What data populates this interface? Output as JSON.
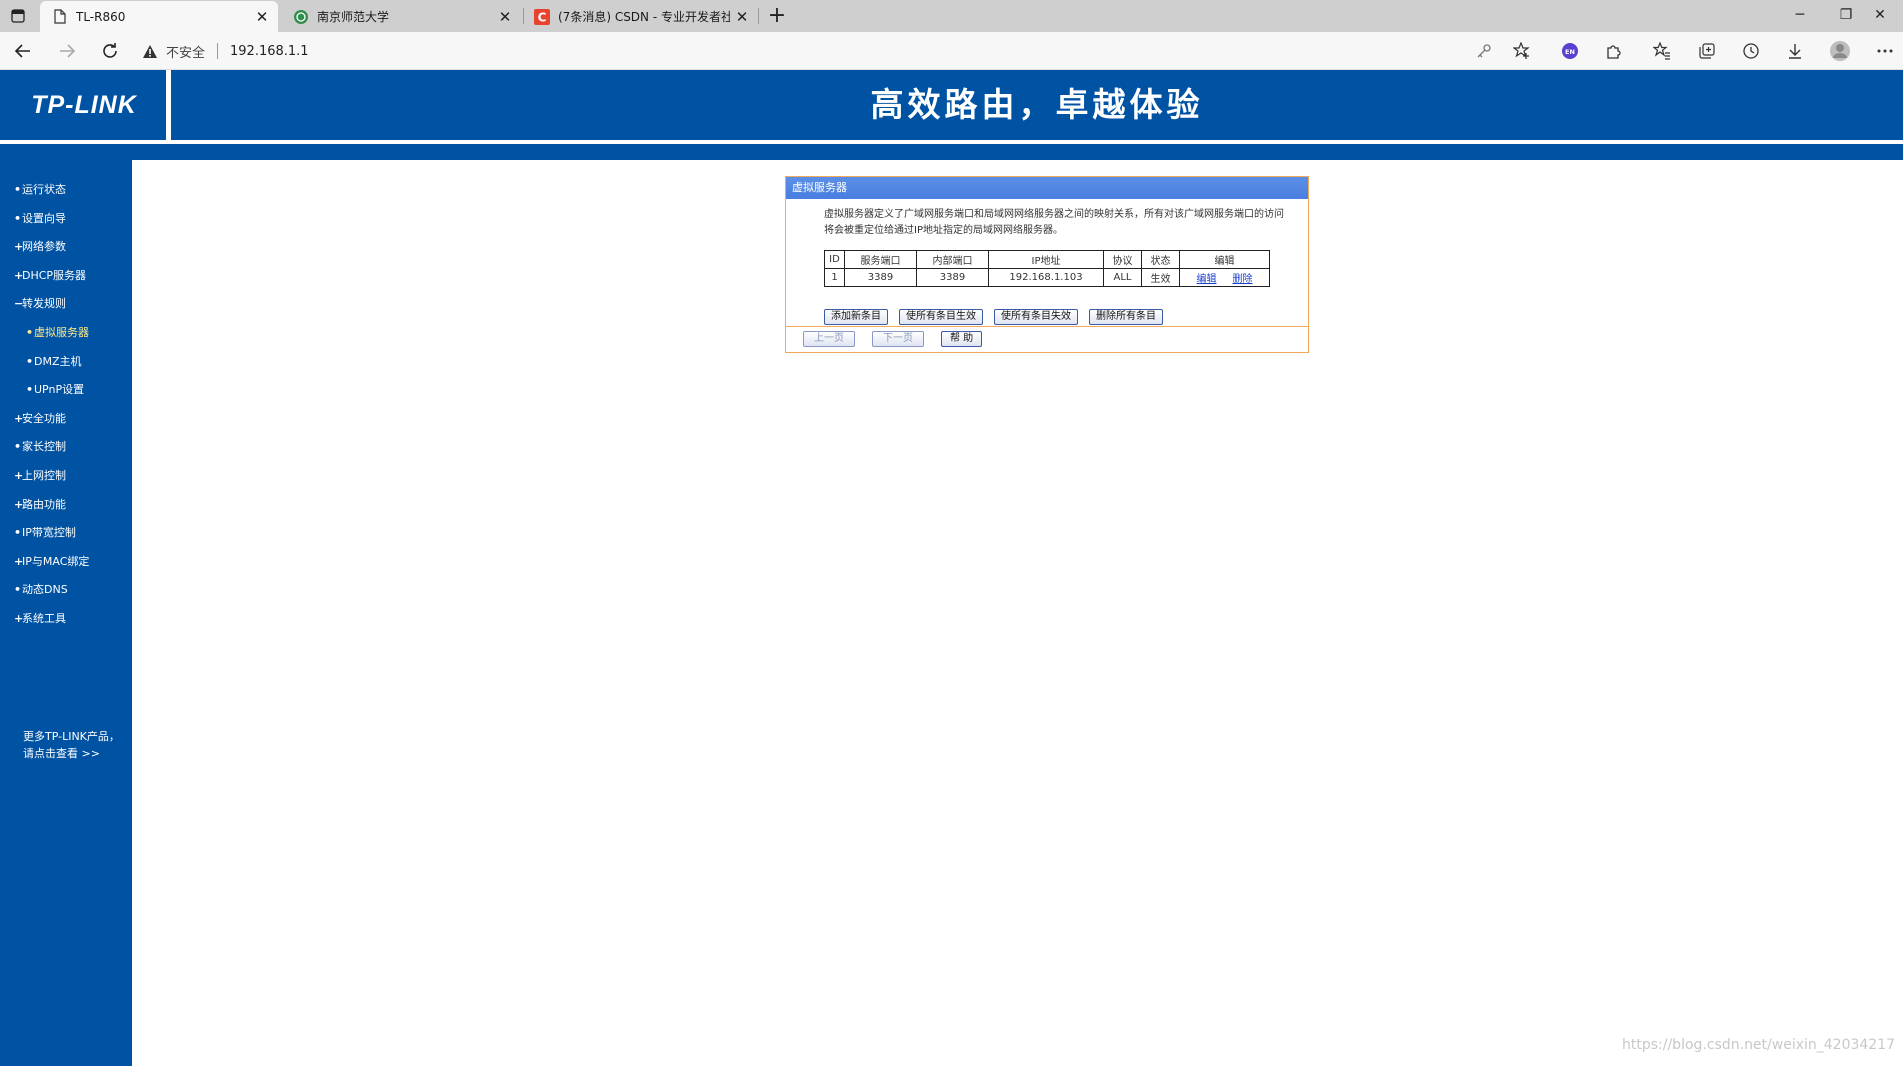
{
  "browser": {
    "tabs": [
      {
        "title": "TL-R860",
        "icon": "page-icon",
        "active": true
      },
      {
        "title": "南京师范大学",
        "icon": "university-icon",
        "active": false
      },
      {
        "title": "(7条消息) CSDN - 专业开发者社",
        "icon": "csdn-icon",
        "active": false
      }
    ],
    "new_tab_label": "+",
    "address": {
      "security_label": "不安全",
      "url": "192.168.1.1"
    },
    "window_controls": {
      "minimize": "─",
      "restore": "❐",
      "close": "✕"
    },
    "extension_badge": "EN"
  },
  "header": {
    "logo": "TP-LINK",
    "slogan": "高效路由，卓越体验"
  },
  "sidebar": {
    "items": [
      {
        "bullet": "•",
        "label": "运行状态"
      },
      {
        "bullet": "•",
        "label": "设置向导"
      },
      {
        "bullet": "+",
        "label": "网络参数"
      },
      {
        "bullet": "+",
        "label": "DHCP服务器"
      },
      {
        "bullet": "−",
        "label": "转发规则"
      },
      {
        "bullet": "•",
        "label": "虚拟服务器",
        "sub": true,
        "active": true
      },
      {
        "bullet": "•",
        "label": "DMZ主机",
        "sub": true
      },
      {
        "bullet": "•",
        "label": "UPnP设置",
        "sub": true
      },
      {
        "bullet": "+",
        "label": "安全功能"
      },
      {
        "bullet": "•",
        "label": "家长控制"
      },
      {
        "bullet": "+",
        "label": "上网控制"
      },
      {
        "bullet": "+",
        "label": "路由功能"
      },
      {
        "bullet": "•",
        "label": "IP带宽控制"
      },
      {
        "bullet": "+",
        "label": "IP与MAC绑定"
      },
      {
        "bullet": "•",
        "label": "动态DNS"
      },
      {
        "bullet": "+",
        "label": "系统工具"
      }
    ],
    "more_line1": "更多TP-LINK产品，",
    "more_line2": "请点击查看 >>"
  },
  "panel": {
    "title": "虚拟服务器",
    "description": "虚拟服务器定义了广域网服务端口和局域网网络服务器之间的映射关系，所有对该广域网服务端口的访问将会被重定位给通过IP地址指定的局域网网络服务器。",
    "table": {
      "headers": [
        "ID",
        "服务端口",
        "内部端口",
        "IP地址",
        "协议",
        "状态",
        "编辑"
      ],
      "rows": [
        {
          "id": "1",
          "service_port": "3389",
          "internal_port": "3389",
          "ip": "192.168.1.103",
          "protocol": "ALL",
          "status": "生效",
          "edit": "编辑",
          "delete": "删除"
        }
      ]
    },
    "buttons": {
      "add": "添加新条目",
      "enable_all": "使所有条目生效",
      "disable_all": "使所有条目失效",
      "delete_all": "删除所有条目"
    },
    "footer": {
      "prev": "上一页",
      "next": "下一页",
      "help": "帮 助"
    }
  },
  "watermark": "https://blog.csdn.net/weixin_42034217"
}
